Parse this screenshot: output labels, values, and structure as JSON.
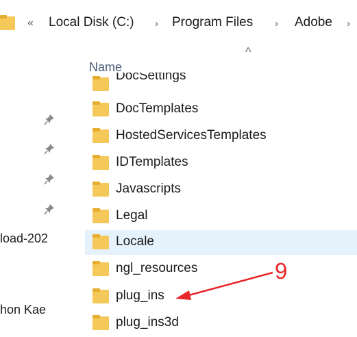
{
  "address_bar": {
    "overflow_chevron": "«",
    "crumbs": [
      "Local Disk (C:)",
      "Program Files",
      "Adobe"
    ],
    "separator": "›",
    "folder_icon": "folder-icon"
  },
  "nav_pane": {
    "items": [
      "load-202",
      "hon Kae"
    ],
    "pin_icon": "pin-icon"
  },
  "file_list": {
    "column_header": "Name",
    "sort_indicator": "^",
    "rows": [
      {
        "name": "DocSettings"
      },
      {
        "name": "DocTemplates"
      },
      {
        "name": "HostedServicesTemplates"
      },
      {
        "name": "IDTemplates"
      },
      {
        "name": "Javascripts"
      },
      {
        "name": "Legal"
      },
      {
        "name": "Locale",
        "selected": true
      },
      {
        "name": "ngl_resources"
      },
      {
        "name": "plug_ins"
      },
      {
        "name": "plug_ins3d"
      }
    ]
  },
  "annotation": {
    "number": "9",
    "color": "#e8262a",
    "target": "plug_ins"
  },
  "colors": {
    "folder": "#f5c85a",
    "folder_dark": "#e6ad2f",
    "selection": "#e5f1fb",
    "header_text": "#4a5e78"
  }
}
